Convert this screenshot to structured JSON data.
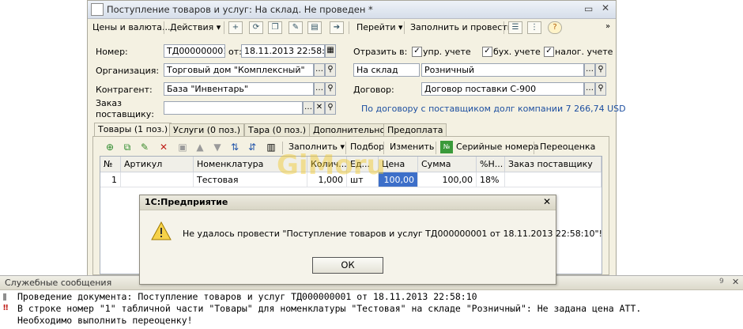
{
  "window": {
    "title": "Поступление товаров и услуг: На склад. Не проведен *"
  },
  "toolbar": {
    "prices_label": "Цены и валюта...",
    "actions_label": "Действия",
    "goto_label": "Перейти",
    "fill_post_label": "Заполнить и провести"
  },
  "form": {
    "number_label": "Номер:",
    "number_value": "ТД000000001",
    "date_label": "от:",
    "date_value": "18.11.2013 22:58:10",
    "reflect_label": "Отразить в:",
    "upr_label": "упр. учете",
    "buh_label": "бух. учете",
    "nalog_label": "налог. учете",
    "org_label": "Организация:",
    "org_value": "Торговый дом \"Комплексный\"",
    "warehouse_type_value": "На склад",
    "warehouse_value": "Розничный",
    "contractor_label": "Контрагент:",
    "contractor_value": "База \"Инвентарь\"",
    "contract_label": "Договор:",
    "contract_value": "Договор поставки С-900",
    "order_label_1": "Заказ",
    "order_label_2": "поставщику:",
    "order_value": "",
    "debt_text": "По договору с поставщиком долг компании 7 266,74 USD"
  },
  "tabs": [
    {
      "label": "Товары (1 поз.)"
    },
    {
      "label": "Услуги (0 поз.)"
    },
    {
      "label": "Тара (0 поз.)"
    },
    {
      "label": "Дополнительно"
    },
    {
      "label": "Предоплата"
    }
  ],
  "table_toolbar": {
    "fill_label": "Заполнить",
    "select_label": "Подбор",
    "change_label": "Изменить",
    "serials_label": "Серийные номера",
    "reprice_label": "Переоценка"
  },
  "table": {
    "columns": [
      "№",
      "Артикул",
      "Номенклатура",
      "Колич...",
      "Ед...",
      "Цена",
      "Сумма",
      "%Н...",
      "Заказ поставщику"
    ],
    "rows": [
      [
        "1",
        "",
        "Тестовая",
        "1,000",
        "шт",
        "100,00",
        "100,00",
        "18%",
        ""
      ]
    ]
  },
  "watermark": "GiMoru",
  "dialog": {
    "title": "1С:Предприятие",
    "message": "Не удалось провести \"Поступление товаров и услуг ТД000000001 от 18.11.2013 22:58:10\"!",
    "ok_label": "ОК"
  },
  "messages": {
    "title": "Служебные сообщения",
    "pin": "9",
    "lines": [
      "Проведение документа: Поступление товаров и услуг ТД000000001 от 18.11.2013 22:58:10",
      "В строке номер \"1\" табличной части \"Товары\" для номенклатуры \"Тестовая\" на складе \"Розничный\": Не задана цена АТТ.",
      "Необходимо выполнить переоценку!"
    ]
  },
  "colors": {
    "selected_cell": "#3d6fc9",
    "link": "#1d4fa0",
    "error_mark": "#c0201a"
  }
}
